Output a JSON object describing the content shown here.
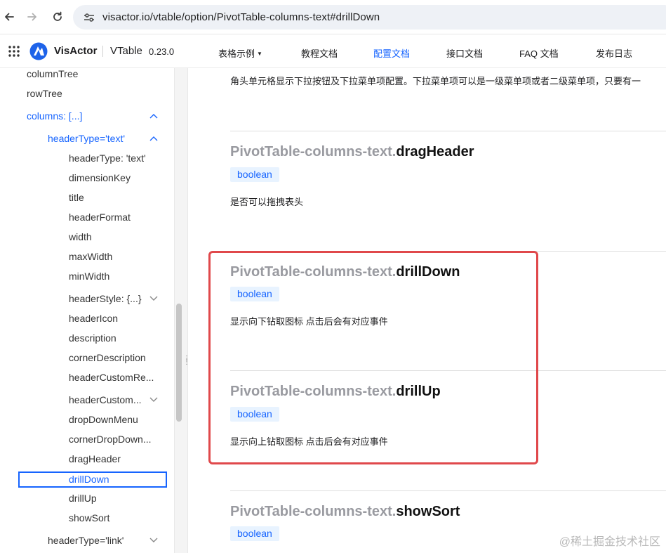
{
  "browser": {
    "url": "visactor.io/vtable/option/PivotTable-columns-text#drillDown"
  },
  "site": {
    "brand": "VisActor",
    "product": "VTable",
    "version": "0.23.0",
    "nav": [
      {
        "label": "表格示例",
        "has_caret": true,
        "active": false
      },
      {
        "label": "教程文档",
        "active": false
      },
      {
        "label": "配置文档",
        "active": true
      },
      {
        "label": "接口文档",
        "active": false
      },
      {
        "label": "FAQ 文档",
        "active": false
      },
      {
        "label": "发布日志",
        "active": false
      }
    ]
  },
  "sidebar": {
    "items": [
      {
        "label": "columnTree"
      },
      {
        "label": "rowTree"
      },
      {
        "label": "columns: [...]",
        "expanded": true
      },
      {
        "label": "headerType='text'",
        "expanded": true
      },
      {
        "label": "headerType: 'text'"
      },
      {
        "label": "dimensionKey"
      },
      {
        "label": "title"
      },
      {
        "label": "headerFormat"
      },
      {
        "label": "width"
      },
      {
        "label": "maxWidth"
      },
      {
        "label": "minWidth"
      },
      {
        "label": "headerStyle: {...}",
        "collapsed": true
      },
      {
        "label": "headerIcon"
      },
      {
        "label": "description"
      },
      {
        "label": "cornerDescription"
      },
      {
        "label": "headerCustomRe..."
      },
      {
        "label": "headerCustom...",
        "collapsed": true
      },
      {
        "label": "dropDownMenu"
      },
      {
        "label": "cornerDropDown..."
      },
      {
        "label": "dragHeader"
      },
      {
        "label": "drillDown",
        "selected": true
      },
      {
        "label": "drillUp"
      },
      {
        "label": "showSort"
      },
      {
        "label": "headerType='link'",
        "collapsed": true
      }
    ]
  },
  "main": {
    "intro": "角头单元格显示下拉按钮及下拉菜单项配置。下拉菜单项可以是一级菜单项或者二级菜单项，只要有一",
    "sections": [
      {
        "prefix": "PivotTable-columns-text.",
        "name": "dragHeader",
        "type": "boolean",
        "desc": "是否可以拖拽表头"
      },
      {
        "prefix": "PivotTable-columns-text.",
        "name": "drillDown",
        "type": "boolean",
        "desc": "显示向下钻取图标 点击后会有对应事件"
      },
      {
        "prefix": "PivotTable-columns-text.",
        "name": "drillUp",
        "type": "boolean",
        "desc": "显示向上钻取图标 点击后会有对应事件"
      },
      {
        "prefix": "PivotTable-columns-text.",
        "name": "showSort",
        "type": "boolean"
      }
    ]
  },
  "watermark": "@稀土掘金技术社区",
  "colors": {
    "accent": "#1664ff",
    "highlight_border": "#e0484b",
    "tag_bg": "#e8f3ff"
  }
}
